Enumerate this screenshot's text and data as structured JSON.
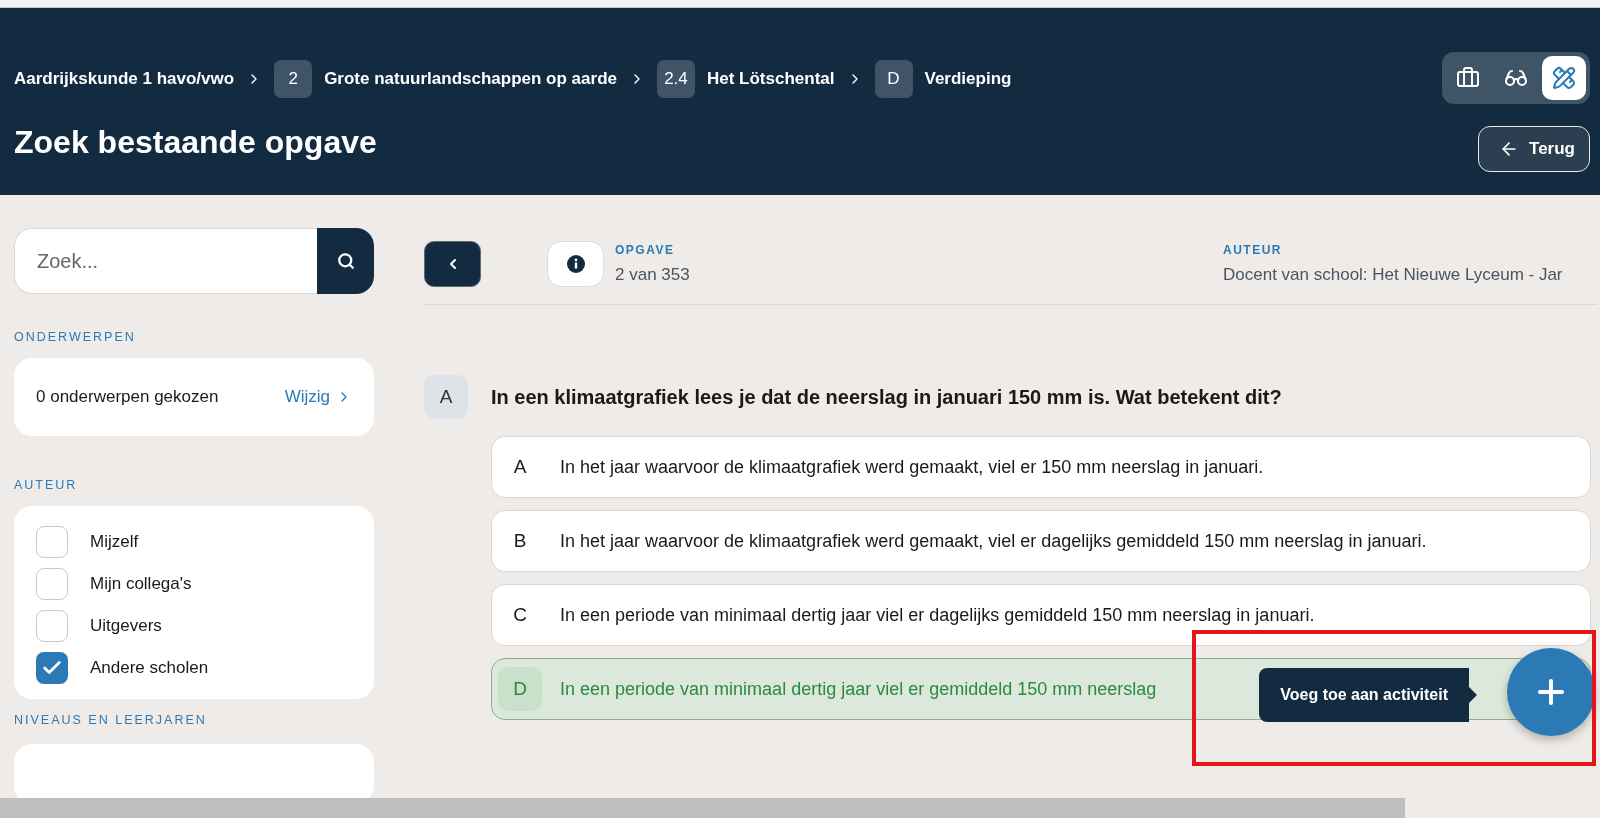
{
  "breadcrumb": [
    {
      "text": "Aardrijkskunde 1 havo/vwo"
    },
    {
      "badge": "2",
      "text": "Grote natuurlandschappen op aarde"
    },
    {
      "badge": "2.4",
      "text": "Het Lötschental"
    },
    {
      "badge": "D",
      "text": "Verdieping"
    }
  ],
  "page_title": "Zoek bestaande opgave",
  "view_modes": [
    {
      "kind": "briefcase",
      "selected": false
    },
    {
      "kind": "glasses",
      "selected": false
    },
    {
      "kind": "ruler",
      "selected": true
    }
  ],
  "back_button": "Terug",
  "sidebar": {
    "search": {
      "placeholder": "Zoek..."
    },
    "topics": {
      "heading": "ONDERWERPEN",
      "summary": "0 onderwerpen gekozen",
      "link": "Wijzig"
    },
    "author_filter": {
      "heading": "AUTEUR",
      "options": [
        {
          "label": "Mijzelf",
          "checked": false
        },
        {
          "label": "Mijn collega's",
          "checked": false
        },
        {
          "label": "Uitgevers",
          "checked": false
        },
        {
          "label": "Andere scholen",
          "checked": true
        }
      ]
    },
    "levels": {
      "heading": "NIVEAUS EN LEERJAREN"
    }
  },
  "question_info": {
    "label": "OPGAVE",
    "value": "2 van 353",
    "author_label": "AUTEUR",
    "author": "Docent van school: Het Nieuwe Lyceum - Jar"
  },
  "question": {
    "letter": "A",
    "text": "In een klimaatgrafiek lees je dat de neerslag in januari 150 mm is. Wat betekent dit?",
    "answers": [
      {
        "letter": "A",
        "text": "In het jaar waarvoor de klimaatgrafiek werd gemaakt, viel er 150 mm neerslag in januari.",
        "correct": false
      },
      {
        "letter": "B",
        "text": "In het jaar waarvoor de klimaatgrafiek werd gemaakt, viel er dagelijks gemiddeld 150 mm neerslag in januari.",
        "correct": false
      },
      {
        "letter": "C",
        "text": "In een periode van minimaal dertig jaar viel er dagelijks gemiddeld 150 mm neerslag in januari.",
        "correct": false
      },
      {
        "letter": "D",
        "text": "In een periode van minimaal dertig jaar viel er gemiddeld 150 mm neerslag",
        "correct": true
      }
    ]
  },
  "tooltip": "Voeg toe aan activiteit"
}
